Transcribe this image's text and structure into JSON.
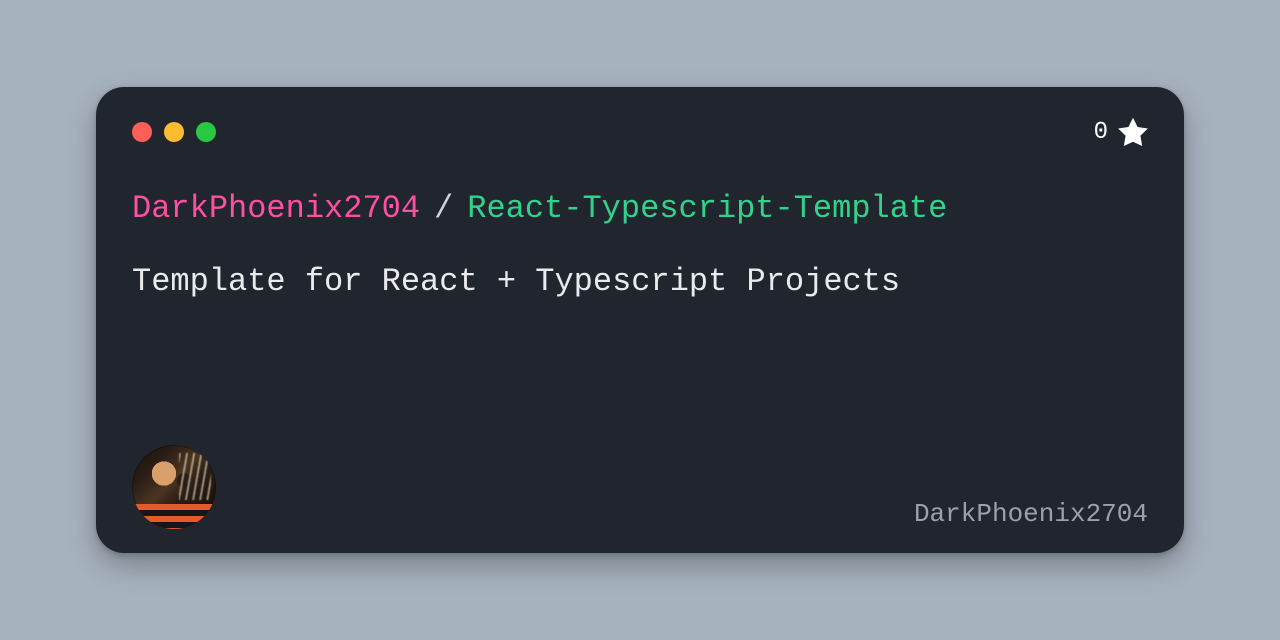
{
  "stars": {
    "count": "0"
  },
  "title": {
    "owner": "DarkPhoenix2704",
    "sep": "/",
    "repo": "React-Typescript-Template"
  },
  "description": "Template for React + Typescript Projects",
  "footer": {
    "username": "DarkPhoenix2704"
  }
}
